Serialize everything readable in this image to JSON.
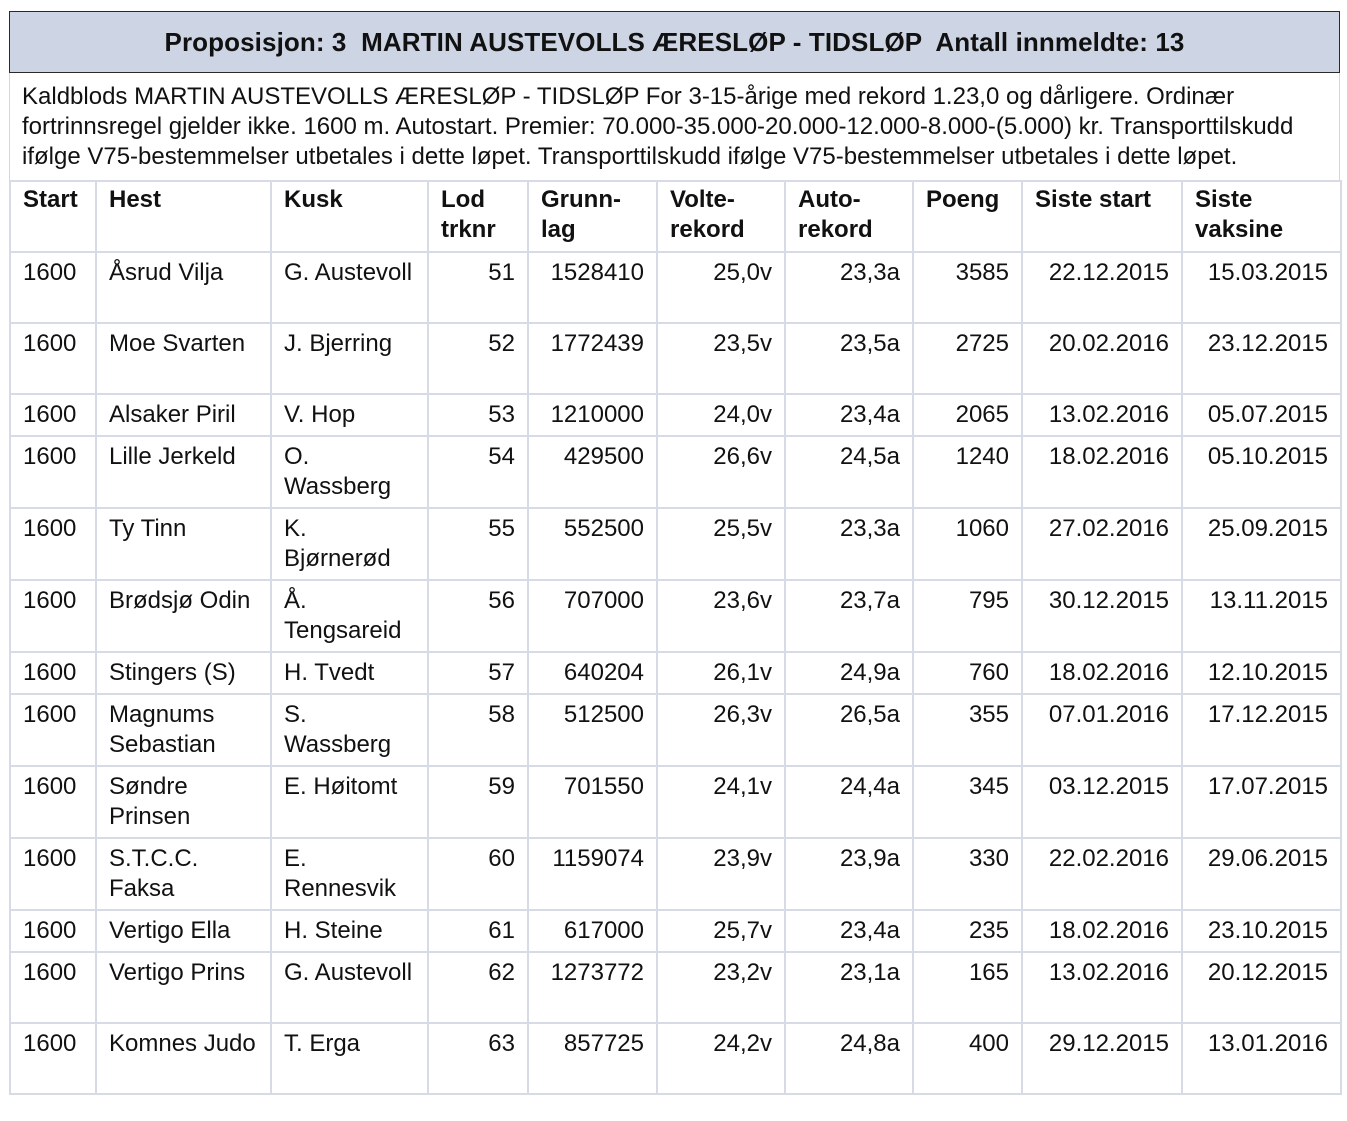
{
  "title": "Proposisjon: 3  MARTIN AUSTEVOLLS ÆRESLØP - TIDSLØP  Antall innmeldte: 13",
  "description": "Kaldblods MARTIN AUSTEVOLLS ÆRESLØP - TIDSLØP For 3-15-årige med rekord 1.23,0 og dårligere. Ordinær fortrinnsregel gjelder ikke. 1600 m. Autostart. Premier: 70.000-35.000-20.000-12.000-8.000-(5.000) kr. Transporttilskudd ifølge V75-bestemmelser utbetales i dette løpet. Transporttilskudd ifølge V75-bestemmelser utbetales i dette løpet.",
  "table": {
    "headers": {
      "start": "Start",
      "hest": "Hest",
      "kusk": "Kusk",
      "lod": "Lod trknr",
      "grunnlag": "Grunn-lag",
      "volte": "Volte-rekord",
      "auto": "Auto-rekord",
      "poeng": "Poeng",
      "siste_start": "Siste start",
      "siste_vaksine": "Siste vaksine"
    },
    "rows": [
      {
        "start": "1600",
        "hest": "Åsrud Vilja",
        "kusk": "G. Austevoll",
        "lod": "51",
        "grunnlag": "1528410",
        "volte": "25,0v",
        "auto": "23,3a",
        "poeng": "3585",
        "siste_start": "22.12.2015",
        "siste_vaksine": "15.03.2015"
      },
      {
        "start": "1600",
        "hest": "Moe Svarten",
        "kusk": "J. Bjerring",
        "lod": "52",
        "grunnlag": "1772439",
        "volte": "23,5v",
        "auto": "23,5a",
        "poeng": "2725",
        "siste_start": "20.02.2016",
        "siste_vaksine": "23.12.2015"
      },
      {
        "start": "1600",
        "hest": "Alsaker Piril",
        "kusk": "V. Hop",
        "lod": "53",
        "grunnlag": "1210000",
        "volte": "24,0v",
        "auto": "23,4a",
        "poeng": "2065",
        "siste_start": "13.02.2016",
        "siste_vaksine": "05.07.2015"
      },
      {
        "start": "1600",
        "hest": "Lille Jerkeld",
        "kusk": "O. Wassberg",
        "lod": "54",
        "grunnlag": "429500",
        "volte": "26,6v",
        "auto": "24,5a",
        "poeng": "1240",
        "siste_start": "18.02.2016",
        "siste_vaksine": "05.10.2015"
      },
      {
        "start": "1600",
        "hest": "Ty Tinn",
        "kusk": "K. Bjørnerød",
        "lod": "55",
        "grunnlag": "552500",
        "volte": "25,5v",
        "auto": "23,3a",
        "poeng": "1060",
        "siste_start": "27.02.2016",
        "siste_vaksine": "25.09.2015"
      },
      {
        "start": "1600",
        "hest": "Brødsjø Odin",
        "kusk": "Å. Tengsareid",
        "lod": "56",
        "grunnlag": "707000",
        "volte": "23,6v",
        "auto": "23,7a",
        "poeng": "795",
        "siste_start": "30.12.2015",
        "siste_vaksine": "13.11.2015"
      },
      {
        "start": "1600",
        "hest": "Stingers (S)",
        "kusk": "H. Tvedt",
        "lod": "57",
        "grunnlag": "640204",
        "volte": "26,1v",
        "auto": "24,9a",
        "poeng": "760",
        "siste_start": "18.02.2016",
        "siste_vaksine": "12.10.2015"
      },
      {
        "start": "1600",
        "hest": "Magnums Sebastian",
        "kusk": "S. Wassberg",
        "lod": "58",
        "grunnlag": "512500",
        "volte": "26,3v",
        "auto": "26,5a",
        "poeng": "355",
        "siste_start": "07.01.2016",
        "siste_vaksine": "17.12.2015"
      },
      {
        "start": "1600",
        "hest": "Søndre Prinsen",
        "kusk": "E. Høitomt",
        "lod": "59",
        "grunnlag": "701550",
        "volte": "24,1v",
        "auto": "24,4a",
        "poeng": "345",
        "siste_start": "03.12.2015",
        "siste_vaksine": "17.07.2015"
      },
      {
        "start": "1600",
        "hest": "S.T.C.C. Faksa",
        "kusk": "E. Rennesvik",
        "lod": "60",
        "grunnlag": "1159074",
        "volte": "23,9v",
        "auto": "23,9a",
        "poeng": "330",
        "siste_start": "22.02.2016",
        "siste_vaksine": "29.06.2015"
      },
      {
        "start": "1600",
        "hest": "Vertigo Ella",
        "kusk": "H. Steine",
        "lod": "61",
        "grunnlag": "617000",
        "volte": "25,7v",
        "auto": "23,4a",
        "poeng": "235",
        "siste_start": "18.02.2016",
        "siste_vaksine": "23.10.2015"
      },
      {
        "start": "1600",
        "hest": "Vertigo Prins",
        "kusk": "G. Austevoll",
        "lod": "62",
        "grunnlag": "1273772",
        "volte": "23,2v",
        "auto": "23,1a",
        "poeng": "165",
        "siste_start": "13.02.2016",
        "siste_vaksine": "20.12.2015"
      },
      {
        "start": "1600",
        "hest": "Komnes Judo",
        "kusk": "T. Erga",
        "lod": "63",
        "grunnlag": "857725",
        "volte": "24,2v",
        "auto": "24,8a",
        "poeng": "400",
        "siste_start": "29.12.2015",
        "siste_vaksine": "13.01.2016"
      }
    ]
  }
}
